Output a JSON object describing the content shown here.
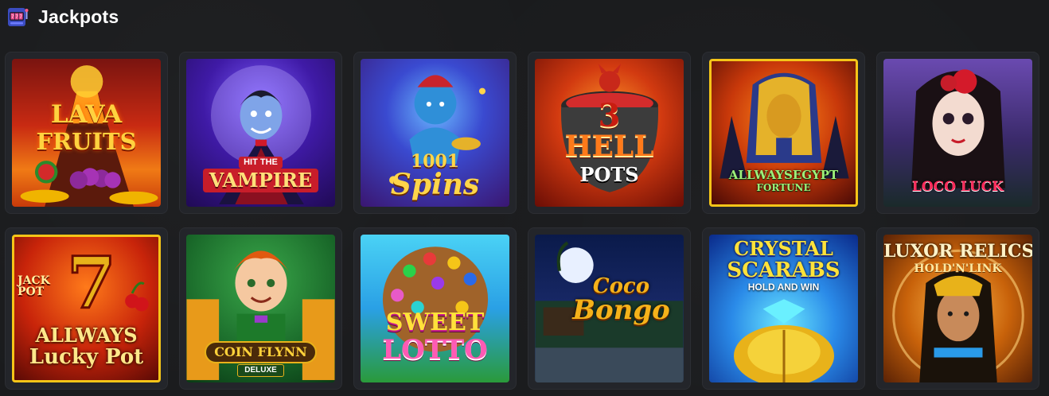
{
  "section": {
    "title": "Jackpots",
    "icon": "slot-machine-icon"
  },
  "games": [
    {
      "name": "lava-fruits",
      "title_lines": [
        "LAVA",
        "FRUITS"
      ],
      "sub": ""
    },
    {
      "name": "hit-the-vampire",
      "title_lines": [
        "HIT THE",
        "VAMPIRE"
      ],
      "sub": ""
    },
    {
      "name": "1001-spins",
      "title_lines": [
        "1001",
        "Spins"
      ],
      "sub": ""
    },
    {
      "name": "3-hell-pots",
      "title_lines": [
        "3",
        "HELL",
        "POTS"
      ],
      "sub": ""
    },
    {
      "name": "allways-egypt-fortune",
      "title_lines": [
        "ALLWAYSEGYPT",
        "FORTUNE"
      ],
      "sub": ""
    },
    {
      "name": "loco-luck",
      "title_lines": [
        "LOCO LUCK"
      ],
      "sub": ""
    },
    {
      "name": "allways-lucky-pot",
      "title_lines": [
        "JACK",
        "POT",
        "ALLWAYS",
        "Lucky Pot"
      ],
      "sub": ""
    },
    {
      "name": "coin-flynn-deluxe",
      "title_lines": [
        "COIN FLYNN"
      ],
      "sub": "DELUXE"
    },
    {
      "name": "sweet-lotto",
      "title_lines": [
        "SWEET",
        "LOTTO"
      ],
      "sub": ""
    },
    {
      "name": "coco-bongo",
      "title_lines": [
        "Coco",
        "Bongo"
      ],
      "sub": ""
    },
    {
      "name": "crystal-scarabs",
      "title_lines": [
        "CRYSTAL",
        "SCARABS"
      ],
      "sub": "HOLD AND WIN"
    },
    {
      "name": "luxor-relics",
      "title_lines": [
        "LUXOR RELICS"
      ],
      "sub": "HOLD'N'LINK"
    }
  ]
}
